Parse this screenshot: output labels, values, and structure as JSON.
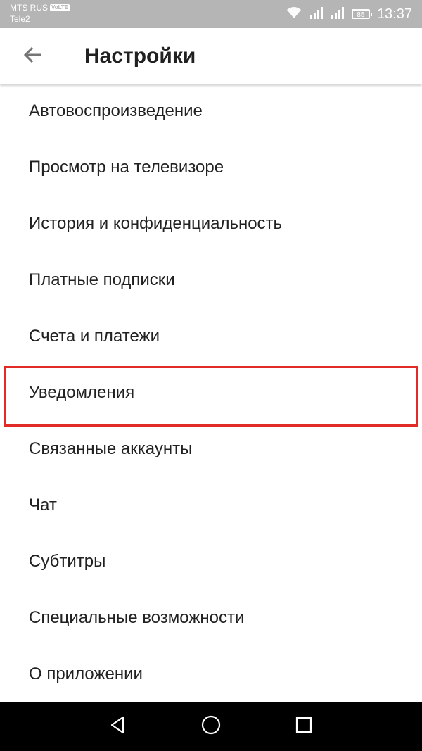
{
  "status_bar": {
    "carrier_primary": "MTS RUS",
    "carrier_badge": "VoLTE",
    "carrier_secondary": "Tele2",
    "battery_level": "85",
    "time": "13:37",
    "icons": [
      "wifi-icon",
      "signal-icon",
      "signal-icon",
      "battery-icon"
    ]
  },
  "app_bar": {
    "back_icon": "arrow-left-icon",
    "title": "Настройки"
  },
  "settings": {
    "items": [
      {
        "label": "Автовоспроизведение"
      },
      {
        "label": "Просмотр на телевизоре"
      },
      {
        "label": "История и конфиденциальность"
      },
      {
        "label": "Платные подписки"
      },
      {
        "label": "Счета и платежи"
      },
      {
        "label": "Уведомления",
        "highlighted": true
      },
      {
        "label": "Связанные аккаунты"
      },
      {
        "label": "Чат"
      },
      {
        "label": "Субтитры"
      },
      {
        "label": "Специальные возможности"
      },
      {
        "label": "О приложении"
      }
    ]
  },
  "nav_bar": {
    "buttons": [
      "back-triangle-icon",
      "home-circle-icon",
      "recents-square-icon"
    ]
  },
  "colors": {
    "status_bar": "#b5b5b5",
    "highlight_border": "#e12b26",
    "text": "#212121",
    "nav_bar": "#000000"
  }
}
